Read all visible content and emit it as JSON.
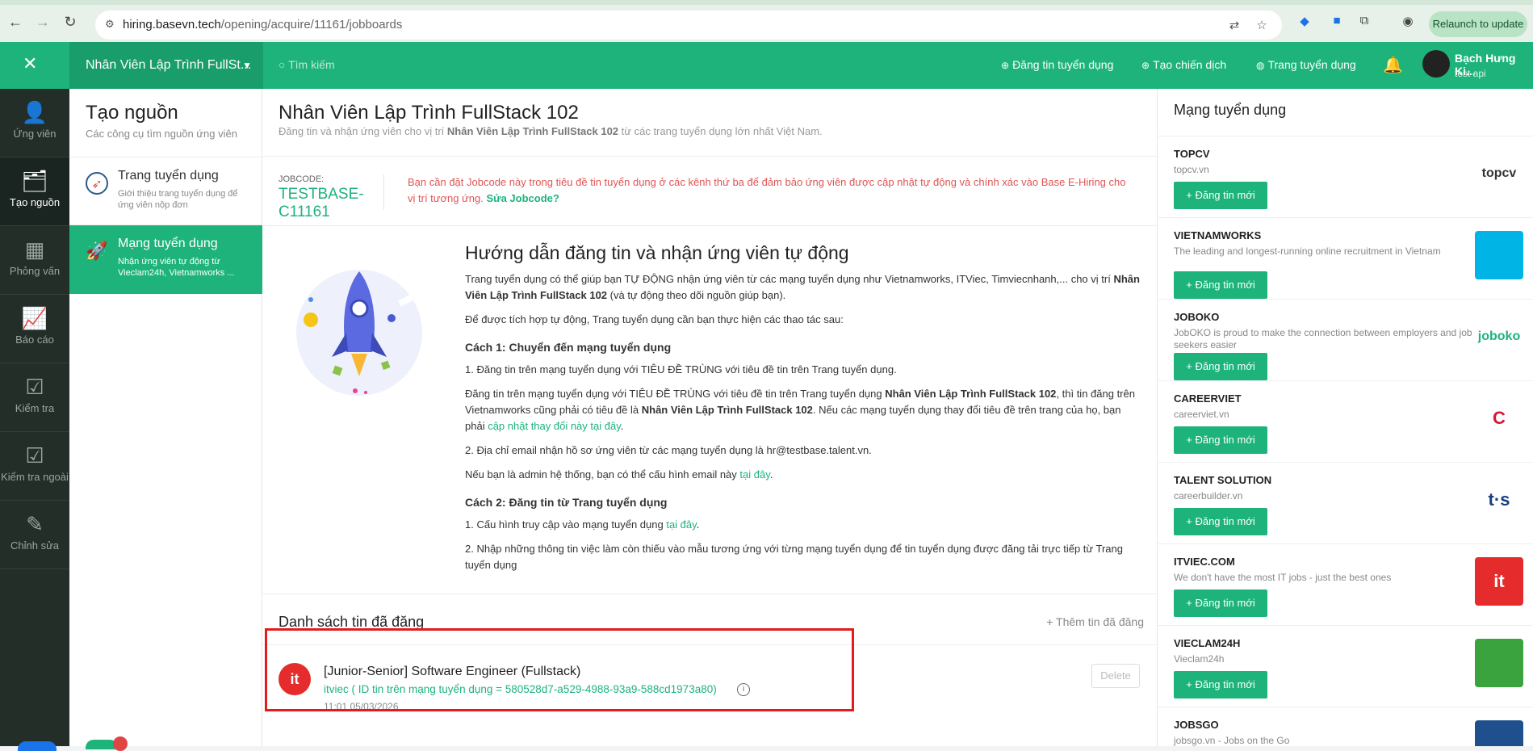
{
  "browser": {
    "url_host": "hiring.basevn.tech",
    "url_path": "/opening/acquire/11161/jobboards",
    "relaunch_label": "Relaunch to update"
  },
  "topbar": {
    "job_selector": "Nhân Viên Lập Trình FullSt...",
    "search_placeholder": "Tìm kiếm",
    "post_job": "Đăng tin tuyển dụng",
    "create_campaign": "Tạo chiến dịch",
    "career_page": "Trang tuyển dụng",
    "user_name": "Bạch Hưng Ki...",
    "user_sub": "test api"
  },
  "left_nav": [
    {
      "label": "Ứng viên",
      "icon": "user-icon"
    },
    {
      "label": "Tạo nguồn",
      "icon": "folder-plus-icon"
    },
    {
      "label": "Phỏng vấn",
      "icon": "calendar-icon"
    },
    {
      "label": "Báo cáo",
      "icon": "chart-line-icon"
    },
    {
      "label": "Kiểm tra",
      "icon": "calendar-check-icon"
    },
    {
      "label": "Kiểm tra ngoài",
      "icon": "calendar-check-icon"
    },
    {
      "label": "Chỉnh sửa",
      "icon": "edit-icon"
    }
  ],
  "source_panel": {
    "title": "Tạo nguồn",
    "subtitle": "Các công cụ tìm nguồn ứng viên",
    "items": [
      {
        "title": "Trang tuyển dụng",
        "desc": "Giới thiệu trang tuyển dụng để ứng viên nộp đơn"
      },
      {
        "title": "Mạng tuyển dụng",
        "desc": "Nhận ứng viên tự động từ Vieclam24h, Vietnamworks ..."
      }
    ]
  },
  "main": {
    "title": "Nhân Viên Lập Trình FullStack 102",
    "subtitle_pre": "Đăng tin và nhận ứng viên cho vị trí",
    "subtitle_bold": "Nhân Viên Lập Trình FullStack 102",
    "subtitle_post": "từ các trang tuyển dụng lớn nhất Việt Nam.",
    "jobcode_label": "JOBCODE:",
    "jobcode": "TESTBASE-C11161",
    "jobcode_warning": "Bạn cần đặt Jobcode này trong tiêu đề tin tuyển dụng ở các kênh thứ ba để đảm bảo ứng viên được cập nhật tự động và chính xác vào Base E-Hiring cho vị trí tương ứng.",
    "jobcode_link": "Sửa Jobcode?",
    "guide_title": "Hướng dẫn đăng tin và nhận ứng viên tự động",
    "g_p1a": "Trang tuyển dụng có thể giúp bạn TỰ ĐỘNG nhận ứng viên từ các mạng tuyển dụng như Vietnamworks, ITViec, Timviecnhanh,... cho vị trí",
    "g_p1b": "Nhân Viên Lập Trình FullStack 102",
    "g_p1c": "(và tự động theo dõi nguồn giúp bạn).",
    "g_p2": "Để được tích hợp tự động, Trang tuyển dụng cần bạn thực hiện các thao tác sau:",
    "g_s1": "Cách 1: Chuyển đến mạng tuyển dụng",
    "g_p3": "1. Đăng tin trên mạng tuyển dụng với TIÊU ĐỀ TRÙNG với tiêu đề tin trên Trang tuyển dụng.",
    "g_p4a": "Đăng tin trên mạng tuyển dụng với TIÊU ĐỀ TRÙNG với tiêu đề tin trên Trang tuyển dụng",
    "g_p4b": "Nhân Viên Lập Trình FullStack 102",
    "g_p4c": ", thì tin đăng trên Vietnamworks cũng phải có tiêu đề là",
    "g_p4d": "Nhân Viên Lập Trình FullStack 102",
    "g_p4e": ". Nếu các mạng tuyển dụng thay đổi tiêu đề trên trang của họ, bạn phải",
    "g_p4link": "cập nhật thay đổi này tại đây",
    "g_p5": "2. Địa chỉ email nhận hồ sơ ứng viên từ các mạng tuyển dụng là hr@testbase.talent.vn.",
    "g_p6a": "Nếu bạn là admin hệ thống, bạn có thể cấu hình email này",
    "g_link_here": "tại đây",
    "g_s2": "Cách 2: Đăng tin từ Trang tuyển dụng",
    "g_p7a": "1. Cấu hình truy cập vào mạng tuyển dụng",
    "g_p8": "2. Nhập những thông tin việc làm còn thiếu vào mẫu tương ứng với từng mạng tuyển dụng để tin tuyển dụng được đăng tải trực tiếp từ Trang tuyển dụng",
    "list_title": "Danh sách tin đã đăng",
    "list_add": "Thêm tin đã đăng",
    "post": {
      "icon_text": "it",
      "title": "[Junior-Senior] Software Engineer (Fullstack)",
      "sub": "itviec ( ID tin trên mạng tuyển dụng = 580528d7-a529-4988-93a9-588cd1973a80)",
      "time": "11:01 05/03/2026",
      "delete": "Delete"
    }
  },
  "networks_panel": {
    "title": "Mạng tuyển dụng",
    "button": "+ Đăng tin mới",
    "items": [
      {
        "name": "TOPCV",
        "desc": "topcv.vn",
        "logo": "topcv",
        "logo_bg": "#ffffff",
        "logo_fg": "#333333"
      },
      {
        "name": "VIETNAMWORKS",
        "desc": "The leading and longest-running online recruitment in Vietnam",
        "logo": "",
        "logo_bg": "#00b4e6",
        "logo_fg": "#ffffff"
      },
      {
        "name": "JOBOKO",
        "desc": "JobOKO is proud to make the connection between employers and job seekers easier",
        "logo": "joboko",
        "logo_bg": "#ffffff",
        "logo_fg": "#1db37b"
      },
      {
        "name": "CAREERVIET",
        "desc": "careerviet.vn",
        "logo": "C",
        "logo_bg": "#ffffff",
        "logo_fg": "#d11a3a"
      },
      {
        "name": "TALENT SOLUTION",
        "desc": "careerbuilder.vn",
        "logo": "t·s",
        "logo_bg": "#ffffff",
        "logo_fg": "#1a3d7c"
      },
      {
        "name": "ITVIEC.COM",
        "desc": "We don't have the most IT jobs - just the best ones",
        "logo": "it",
        "logo_bg": "#e52b2b",
        "logo_fg": "#ffffff"
      },
      {
        "name": "VIECLAM24H",
        "desc": "Vieclam24h",
        "logo": "",
        "logo_bg": "#3aa33d",
        "logo_fg": "#ffffff"
      },
      {
        "name": "JOBSGO",
        "desc": "jobsgo.vn - Jobs on the Go",
        "logo": "",
        "logo_bg": "#1f4f8c",
        "logo_fg": "#ffffff"
      }
    ]
  }
}
